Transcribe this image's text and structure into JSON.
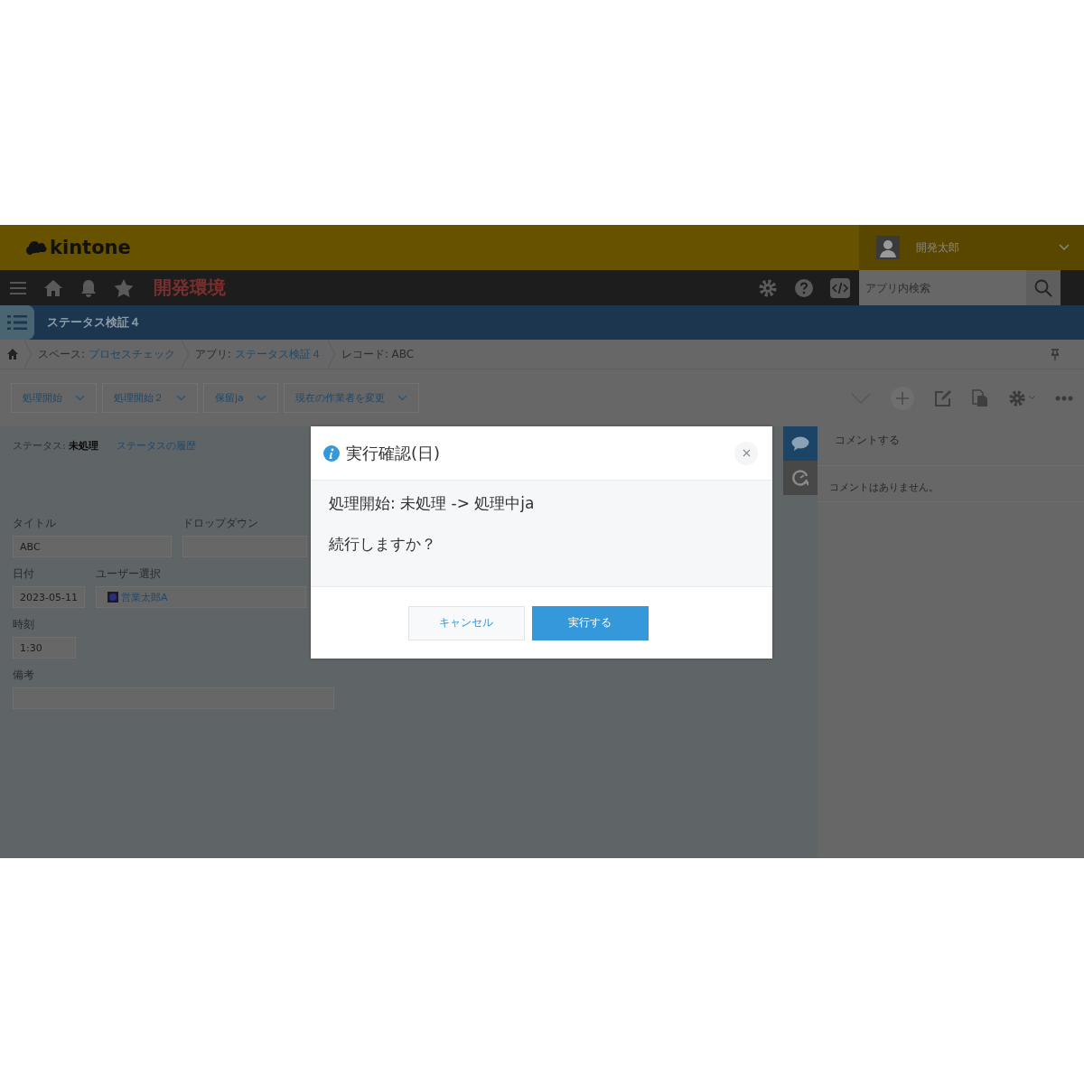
{
  "header": {
    "logo": "kintone",
    "user": "開発太郎"
  },
  "nav": {
    "env_title": "開発環境",
    "search": {
      "placeholder": "アプリ内検索"
    }
  },
  "app_bar": {
    "title": "ステータス検証４"
  },
  "breadcrumb": [
    {
      "label": "スペース: ",
      "link": "プロセスチェック"
    },
    {
      "label": "アプリ: ",
      "link": "ステータス検証４"
    },
    {
      "label": "レコード: ABC"
    }
  ],
  "actions": [
    "処理開始",
    "処理開始２",
    "保留ja",
    "現在の作業者を変更"
  ],
  "status": {
    "label": "ステータス: ",
    "value": "未処理",
    "history_link": "ステータスの履歴"
  },
  "field_rows": [
    [
      {
        "kind": "text",
        "label": "タイトル",
        "value": "ABC"
      },
      {
        "kind": "dropdown",
        "label": "ドロップダウン"
      }
    ],
    [
      {
        "kind": "date",
        "label": "日付",
        "value": "2023-05-11"
      },
      {
        "kind": "user",
        "label": "ユーザー選択",
        "value": "営業太郎A"
      }
    ],
    [
      {
        "kind": "time",
        "label": "時刻",
        "value": "1:30"
      }
    ],
    [
      {
        "kind": "note",
        "label": "備考"
      }
    ]
  ],
  "side_tabs": [
    {
      "kind": "comment",
      "selected": true
    },
    {
      "kind": "history",
      "selected": false
    }
  ],
  "comments": {
    "placeholder": "コメントする",
    "empty": "コメントはありません。"
  },
  "dialog": {
    "title": "実行確認(日)",
    "lines": [
      "処理開始: 未処理 -> 処理中ja",
      "続行しますか？"
    ],
    "buttons": [
      {
        "label": "キャンセル",
        "kind": "secondary"
      },
      {
        "label": "実行する",
        "kind": "primary"
      }
    ]
  }
}
